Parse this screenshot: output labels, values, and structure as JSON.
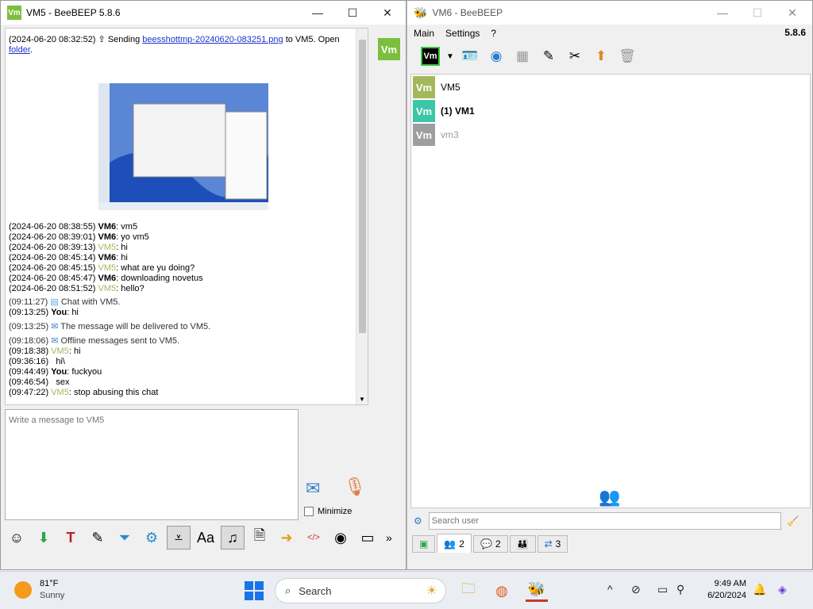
{
  "left_window": {
    "title": "VM5 - BeeBEEP 5.8.6",
    "badge": "Vm",
    "controls": {
      "minimize": "—",
      "maximize": "☐",
      "close": "✕"
    },
    "side_badge": "Vm",
    "send_line": {
      "timestamp": "(2024-06-20 08:32:52)",
      "prefix": "Sending",
      "filename": "beesshottmp-20240620-083251.png",
      "middle": "to VM5. Open",
      "folder": "folder",
      "end": "."
    },
    "messages": [
      {
        "time": "(2024-06-20 08:38:55)",
        "sender": "VM6",
        "text": "vm5"
      },
      {
        "time": "(2024-06-20 08:39:01)",
        "sender": "VM6",
        "text": "yo vm5"
      },
      {
        "time": "(2024-06-20 08:39:13)",
        "sender": "VM5",
        "text": "hi"
      },
      {
        "time": "(2024-06-20 08:45:14)",
        "sender": "VM6",
        "text": "hi"
      },
      {
        "time": "(2024-06-20 08:45:15)",
        "sender": "VM5",
        "text": "what are yu doing?"
      },
      {
        "time": "(2024-06-20 08:45:47)",
        "sender": "VM6",
        "text": "downloading novetus"
      },
      {
        "time": "(2024-06-20 08:51:52)",
        "sender": "VM5",
        "text": "hello?"
      }
    ],
    "system_lines": [
      {
        "time": "(09:11:27)",
        "text": "Chat with VM5."
      },
      {
        "time": "(09:13:25)",
        "sender": "You",
        "text": "hi"
      },
      {
        "time": "(09:13:25)",
        "text": "The message will be delivered to VM5."
      },
      {
        "time": "(09:18:06)",
        "text": "Offline messages sent to VM5."
      },
      {
        "time": "(09:18:38)",
        "sender": "VM5",
        "text": "hi"
      },
      {
        "time": "(09:36:16)",
        "text": "hi\\"
      },
      {
        "time": "(09:44:49)",
        "sender": "You",
        "text": "fuckyou"
      },
      {
        "time": "(09:46:54)",
        "text": "sex"
      },
      {
        "time": "(09:47:22)",
        "sender": "VM5",
        "text": "stop abusing this chat"
      }
    ],
    "input_placeholder": "Write a message to VM5",
    "minimize_label": "Minimize",
    "more_label": "»"
  },
  "right_window": {
    "title": "VM6 - BeeBEEP",
    "controls": {
      "minimize": "—",
      "maximize": "☐",
      "close": "✕"
    },
    "menu": [
      "Main",
      "Settings",
      "?"
    ],
    "version": "5.8.6",
    "toolbar_status_badge": "Vm",
    "users": [
      {
        "badge": "Vm",
        "name": "VM5",
        "color": "#a3b85a"
      },
      {
        "badge": "Vm",
        "name": "(1) VM1",
        "color": "#3cc6a8"
      },
      {
        "badge": "Vm",
        "name": "vm3",
        "color": "#9e9e9e"
      }
    ],
    "search_placeholder": "Search user",
    "tabs": [
      {
        "count": "2"
      },
      {
        "count": "2"
      },
      {
        "count": ""
      },
      {
        "count": "3"
      }
    ]
  },
  "taskbar": {
    "temperature": "81°F",
    "condition": "Sunny",
    "search_label": "Search",
    "time": "9:49 AM",
    "date": "6/20/2024"
  }
}
